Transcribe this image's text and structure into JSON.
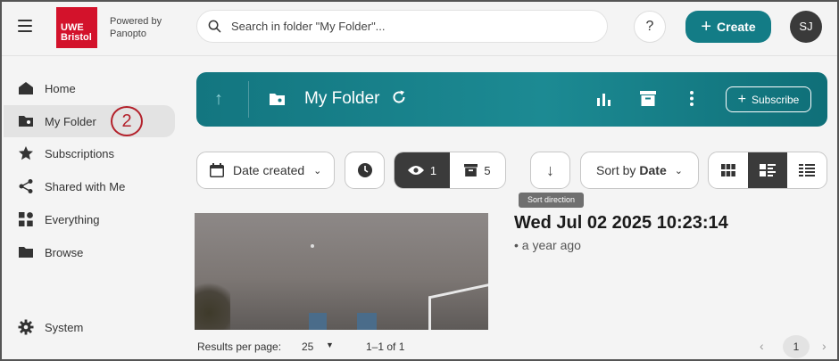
{
  "header": {
    "logo_line1": "UWE",
    "logo_line2": "Bristol",
    "powered_line1": "Powered by",
    "powered_line2": "Panopto",
    "search_placeholder": "Search in folder \"My Folder\"...",
    "help_label": "?",
    "create_label": "Create",
    "avatar_initials": "SJ"
  },
  "sidebar": {
    "items": [
      {
        "label": "Home",
        "icon": "home-icon"
      },
      {
        "label": "My Folder",
        "icon": "folder-icon",
        "active": true
      },
      {
        "label": "Subscriptions",
        "icon": "star-icon"
      },
      {
        "label": "Shared with Me",
        "icon": "share-icon"
      },
      {
        "label": "Everything",
        "icon": "grid-icon"
      },
      {
        "label": "Browse",
        "icon": "folder-icon"
      }
    ],
    "system_label": "System",
    "step_marker": "2"
  },
  "folder": {
    "title": "My Folder",
    "subscribe_label": "Subscribe"
  },
  "toolbar": {
    "date_filter": "Date created",
    "visible_count": "1",
    "archived_count": "5",
    "sort_tooltip": "Sort direction",
    "sort_prefix": "Sort by",
    "sort_value": "Date"
  },
  "result": {
    "title": "Wed Jul 02 2025 10:23:14",
    "age": "• a year ago"
  },
  "footer": {
    "results_label": "Results per page:",
    "results_value": "25",
    "range": "1–1 of 1",
    "page": "1"
  },
  "colors": {
    "accent": "#137c86",
    "brand": "#d3122b",
    "step_marker": "#b3212b"
  }
}
